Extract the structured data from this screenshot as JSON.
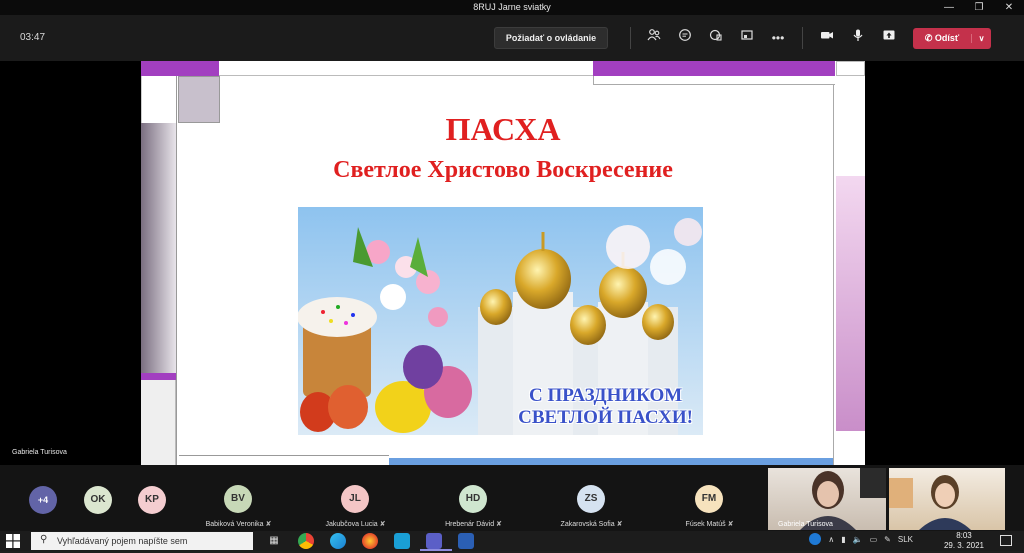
{
  "window": {
    "title": "8RUJ Jarne sviatky"
  },
  "meeting": {
    "timer": "03:47",
    "request_control_label": "Požiadať o ovládanie",
    "leave_label": "Odísť"
  },
  "slide": {
    "title": "ПАСХА",
    "subtitle": "Светлое Христово Воскресение",
    "greeting_line1": "С ПРАЗДНИКОМ",
    "greeting_line2": "СВЕТЛОЙ ПАСХИ!",
    "accent_color": "#e02020",
    "purple_color": "#a23fc0"
  },
  "presenter": {
    "name": "Gabriela Turisova"
  },
  "roster": {
    "more_count": "+4",
    "avatar_initials": [
      "OK",
      "KP"
    ],
    "participants": [
      {
        "initials": "BV",
        "name": "Babiková Veronika",
        "color": "#c7d8b7"
      },
      {
        "initials": "JL",
        "name": "Jakubčova Lucia",
        "color": "#f4c6c6"
      },
      {
        "initials": "HD",
        "name": "Hrebenár Dávid",
        "color": "#cfe6cf"
      },
      {
        "initials": "ZS",
        "name": "Zakarovská Sofia",
        "color": "#d5e2f0"
      },
      {
        "initials": "FM",
        "name": "Fúsek Matúš",
        "color": "#f6e2bd"
      }
    ],
    "video_names": [
      "Gabriela Turisova"
    ]
  },
  "taskbar": {
    "search_placeholder": "Vyhľadávaný pojem napíšte sem",
    "language": "SLK",
    "time": "8:03",
    "date": "29. 3. 2021"
  }
}
